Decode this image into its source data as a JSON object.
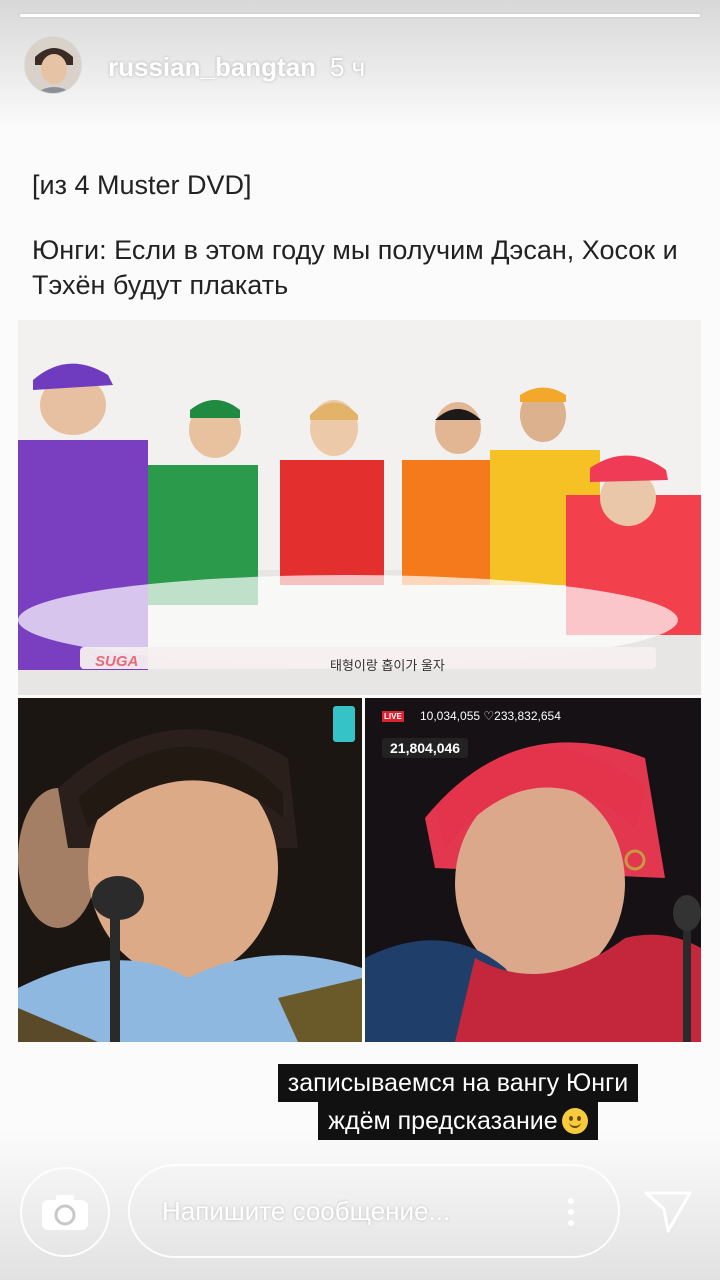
{
  "story": {
    "progress": 1.0,
    "username": "russian_bangtan",
    "timestamp": "5 ч"
  },
  "post": {
    "source": "[из 4 Muster DVD]",
    "quote": "Юнги: Если в этом году мы получим Дэсан, Хосок и Тэхён будут плакать"
  },
  "images": {
    "top": {
      "caption_name": "SUGA",
      "caption_text": "태형이랑 홉이가 울자"
    },
    "right": {
      "live_label": "LIVE",
      "stats": "10,034,055 ♡233,832,654",
      "counter": "21,804,046"
    }
  },
  "sticker": {
    "line1": "записываемся на вангу Юнги",
    "line2": "ждём предсказание"
  },
  "composer": {
    "placeholder": "Напишите сообщение..."
  },
  "icons": {
    "camera": "camera-icon",
    "more": "more-vertical-icon",
    "send": "send-icon"
  }
}
